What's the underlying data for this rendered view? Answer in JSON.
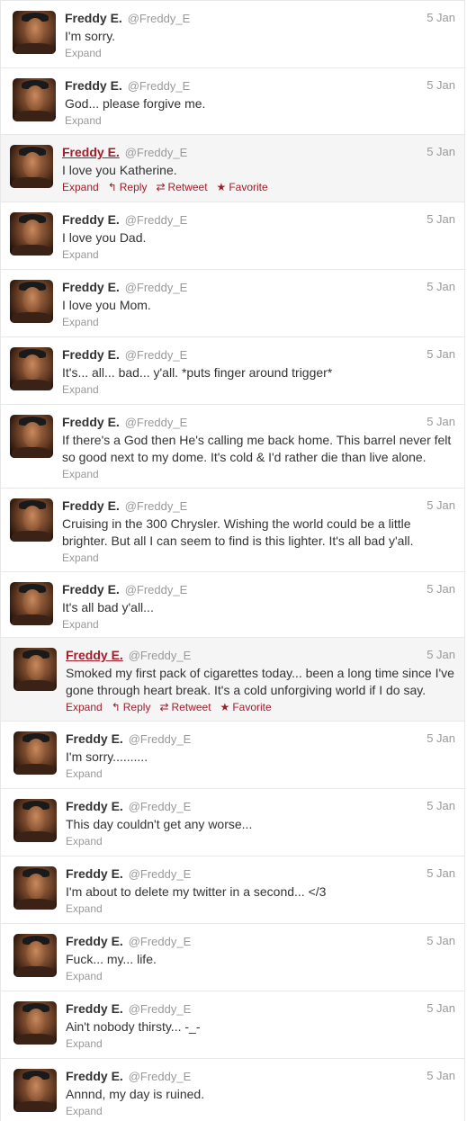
{
  "tweets": [
    {
      "name": "Freddy E.",
      "handle": "@Freddy_E",
      "time": "5 Jan",
      "text": "I'm sorry.",
      "expand": "Expand"
    },
    {
      "name": "Freddy E.",
      "handle": "@Freddy_E",
      "time": "5 Jan",
      "text": "God... please forgive me.",
      "expand": "Expand"
    },
    {
      "name": "Freddy E.",
      "handle": "@Freddy_E",
      "time": "5 Jan",
      "text": "I love you Katherine.",
      "expand": "Expand",
      "reply": "Reply",
      "retweet": "Retweet",
      "favorite": "Favorite"
    },
    {
      "name": "Freddy E.",
      "handle": "@Freddy_E",
      "time": "5 Jan",
      "text": "I love you Dad.",
      "expand": "Expand"
    },
    {
      "name": "Freddy E.",
      "handle": "@Freddy_E",
      "time": "5 Jan",
      "text": "I love you Mom.",
      "expand": "Expand"
    },
    {
      "name": "Freddy E.",
      "handle": "@Freddy_E",
      "time": "5 Jan",
      "text": "It's... all... bad... y'all. *puts finger around trigger*",
      "expand": "Expand"
    },
    {
      "name": "Freddy E.",
      "handle": "@Freddy_E",
      "time": "5 Jan",
      "text": "If there's a God then He's calling me back home. This barrel never felt so good next to my dome. It's cold & I'd rather die than live alone.",
      "expand": "Expand"
    },
    {
      "name": "Freddy E.",
      "handle": "@Freddy_E",
      "time": "5 Jan",
      "text": "Cruising in the 300 Chrysler. Wishing the world could be a little brighter. But all I can seem to find is this lighter. It's all bad y'all.",
      "expand": "Expand"
    },
    {
      "name": "Freddy E.",
      "handle": "@Freddy_E",
      "time": "5 Jan",
      "text": "It's all bad y'all...",
      "expand": "Expand"
    },
    {
      "name": "Freddy E.",
      "handle": "@Freddy_E",
      "time": "5 Jan",
      "text": "Smoked my first pack of cigarettes today... been a long time since I've gone through heart break. It's a cold unforgiving world if I do say.",
      "expand": "Expand",
      "reply": "Reply",
      "retweet": "Retweet",
      "favorite": "Favorite"
    },
    {
      "name": "Freddy E.",
      "handle": "@Freddy_E",
      "time": "5 Jan",
      "text": "I'm sorry..........",
      "expand": "Expand"
    },
    {
      "name": "Freddy E.",
      "handle": "@Freddy_E",
      "time": "5 Jan",
      "text": "This day couldn't get any worse...",
      "expand": "Expand"
    },
    {
      "name": "Freddy E.",
      "handle": "@Freddy_E",
      "time": "5 Jan",
      "text": "I'm about to delete my twitter in a second... </3",
      "expand": "Expand"
    },
    {
      "name": "Freddy E.",
      "handle": "@Freddy_E",
      "time": "5 Jan",
      "text": "Fuck... my... life.",
      "expand": "Expand"
    },
    {
      "name": "Freddy E.",
      "handle": "@Freddy_E",
      "time": "5 Jan",
      "text": "Ain't nobody thirsty... -_-",
      "expand": "Expand"
    },
    {
      "name": "Freddy E.",
      "handle": "@Freddy_E",
      "time": "5 Jan",
      "text": "Annnd, my day is ruined.",
      "expand": "Expand"
    }
  ]
}
